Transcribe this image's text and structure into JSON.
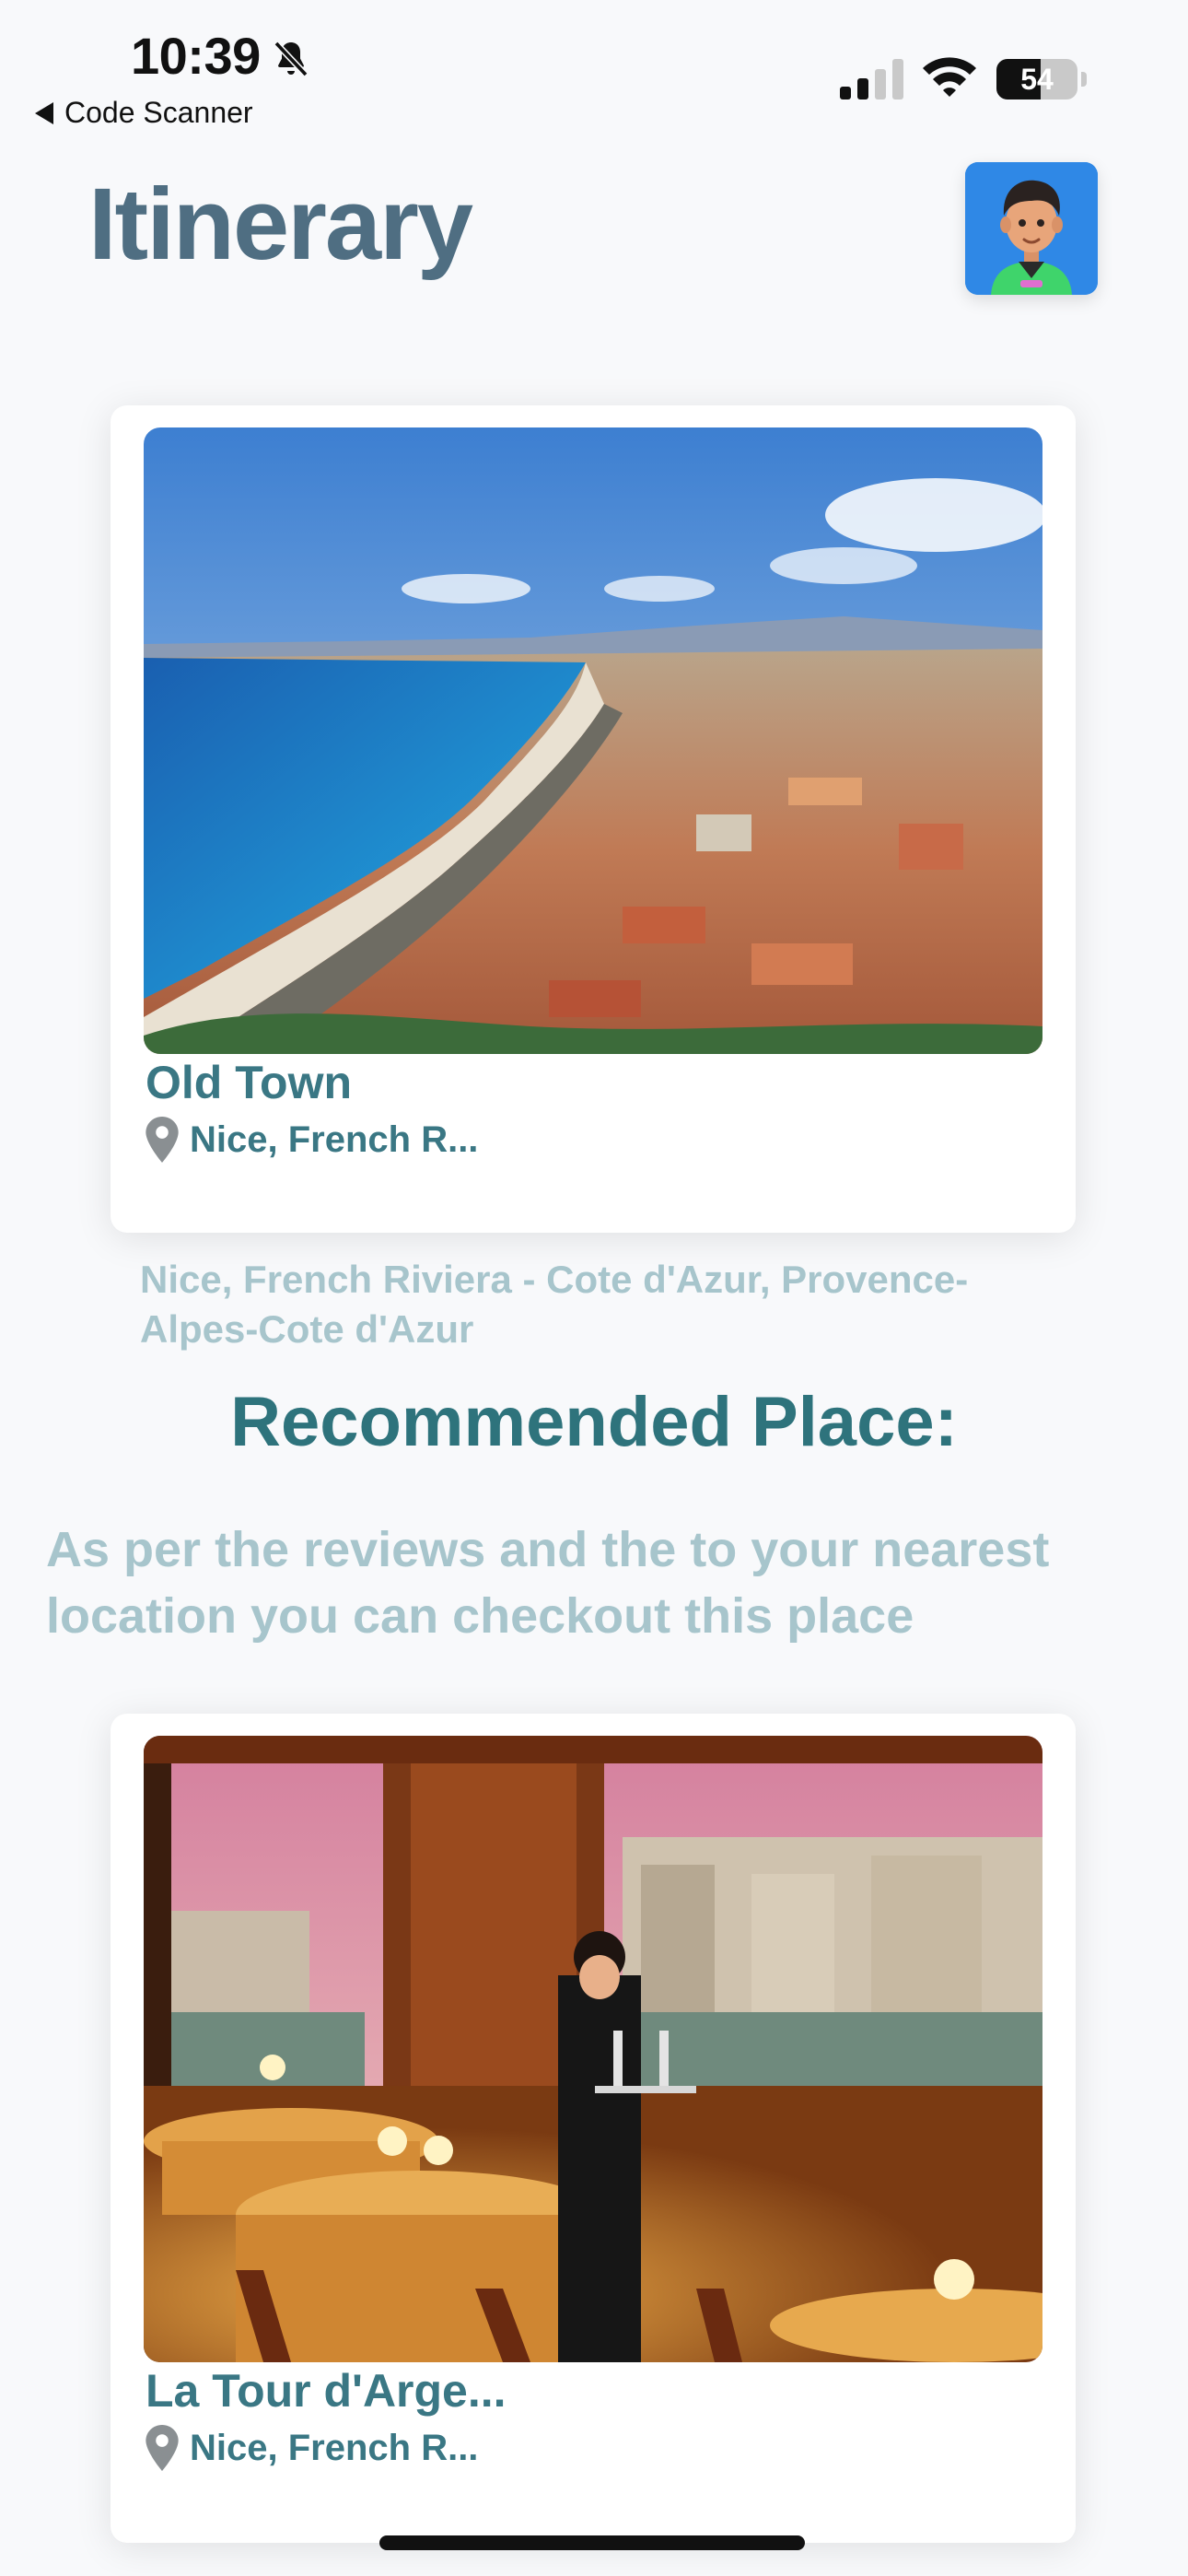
{
  "status_bar": {
    "time": "10:39",
    "battery_level": "54",
    "battery_fraction": 0.54,
    "back_app": "Code Scanner"
  },
  "header": {
    "title": "Itinerary",
    "avatar_icon": "cartoon-user-avatar"
  },
  "itinerary_card": {
    "name": "Old Town",
    "location": "Nice, French R...",
    "location_icon": "map-pin-icon"
  },
  "full_address": "Nice, French Riviera - Cote d'Azur, Provence-Alpes-Cote d'Azur",
  "recommended": {
    "title": "Recommended Place:",
    "description": "As per the reviews and the to your nearest location you can checkout this place"
  },
  "recommended_card": {
    "name": "La Tour d'Arge...",
    "location": "Nice, French R...",
    "location_icon": "map-pin-icon"
  },
  "colors": {
    "title": "#4f6e82",
    "accent": "#3a7784",
    "muted_text": "#a7c5cc",
    "background": "#f8f9fb"
  }
}
